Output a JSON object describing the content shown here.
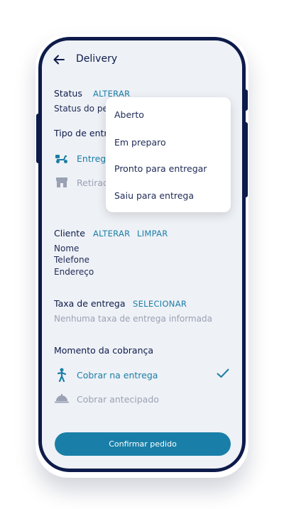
{
  "header": {
    "title": "Delivery"
  },
  "status": {
    "label": "Status",
    "action": "ALTERAR",
    "value": "Status do pe",
    "menu": [
      "Aberto",
      "Em preparo",
      "Pronto para entregar",
      "Saiu para entrega"
    ]
  },
  "delivery_type": {
    "label": "Tipo de entr",
    "options": [
      {
        "label": "Entreg",
        "icon": "scooter-icon",
        "active": true
      },
      {
        "label": "Retirad",
        "icon": "store-icon",
        "active": false
      }
    ]
  },
  "client": {
    "label": "Cliente",
    "action_change": "ALTERAR",
    "action_clear": "LIMPAR",
    "fields": [
      "Nome",
      "Telefone",
      "Endereço"
    ]
  },
  "fee": {
    "label": "Taxa de entrega",
    "action": "SELECIONAR",
    "empty": "Nenhuma taxa de entrega informada"
  },
  "billing": {
    "label": "Momento da cobrança",
    "options": [
      {
        "label": "Cobrar na entrega",
        "icon": "person-walking-icon",
        "active": true
      },
      {
        "label": "Cobrar antecipado",
        "icon": "service-bell-icon",
        "active": false
      }
    ]
  },
  "confirm_label": "Confirmar pedido",
  "colors": {
    "accent": "#1a7fa8",
    "frame": "#0d1b4a",
    "background": "#eef1f6"
  }
}
